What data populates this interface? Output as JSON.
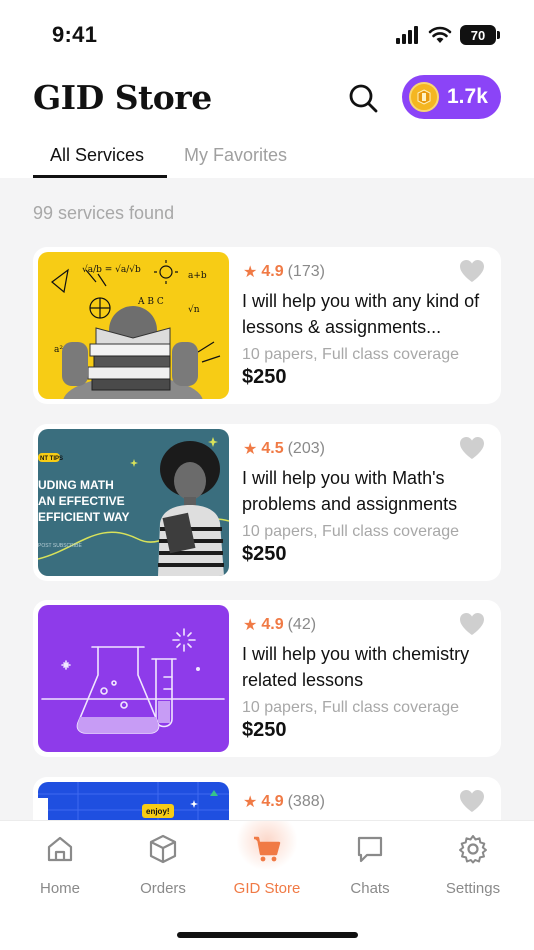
{
  "status_bar": {
    "time": "9:41",
    "battery": "70"
  },
  "header": {
    "title": "GID Store",
    "coins": "1.7k"
  },
  "tabs": [
    {
      "label": "All Services",
      "active": true
    },
    {
      "label": "My Favorites",
      "active": false
    }
  ],
  "results_text": "99 services found",
  "services": [
    {
      "rating": "4.9",
      "reviews": "(173)",
      "title": "I will help you with any kind of lessons & assignments...",
      "details": "10 papers, Full class coverage",
      "price": "$250"
    },
    {
      "rating": "4.5",
      "reviews": "(203)",
      "title": "I will help you with Math's problems and assignments",
      "details": "10 papers, Full class coverage",
      "price": "$250",
      "thumb_text": [
        "UDING MATH",
        "AN EFFECTIVE",
        "EFFICIENT WAY"
      ],
      "thumb_tag": "NT TIPS",
      "thumb_small": "POST SUBSCRIBE"
    },
    {
      "rating": "4.9",
      "reviews": "(42)",
      "title": "I will help you with chemistry related lessons",
      "details": "10 papers, Full class coverage",
      "price": "$250"
    },
    {
      "rating": "4.9",
      "reviews": "(388)",
      "thumb_text": "enjoy!"
    }
  ],
  "bottom_nav": [
    {
      "label": "Home",
      "icon": "home-icon"
    },
    {
      "label": "Orders",
      "icon": "box-icon"
    },
    {
      "label": "GID Store",
      "icon": "cart-icon",
      "active": true
    },
    {
      "label": "Chats",
      "icon": "chat-icon"
    },
    {
      "label": "Settings",
      "icon": "gear-icon"
    }
  ],
  "colors": {
    "accent": "#f07a45",
    "brand_purple": "#8b44f7",
    "card_yellow": "#f7cc15",
    "card_teal": "#3a6e7e",
    "card_purple": "#8e3bea",
    "card_blue": "#1f4fe0"
  }
}
